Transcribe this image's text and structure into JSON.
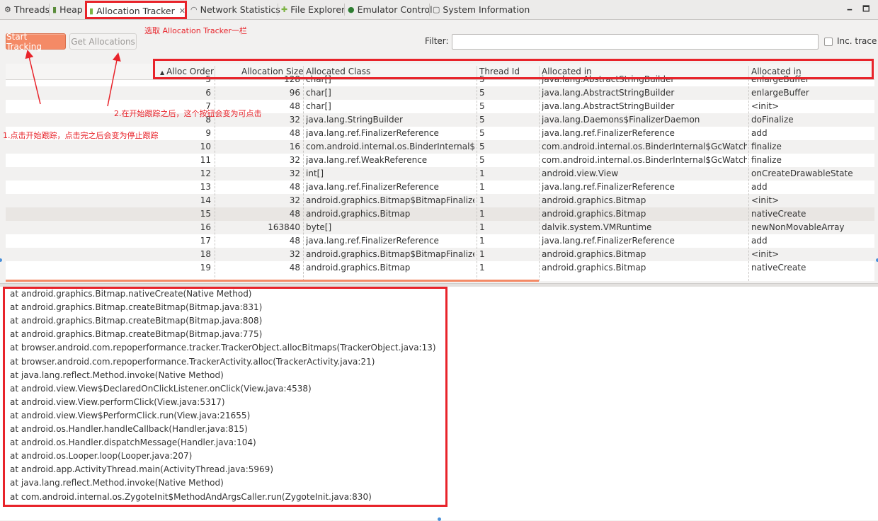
{
  "tabs": [
    {
      "label": "Threads",
      "icon": "threads-icon"
    },
    {
      "label": "Heap",
      "icon": "heap-icon"
    },
    {
      "label": "Allocation Tracker",
      "icon": "android-icon",
      "active": true
    },
    {
      "label": "Network Statistics",
      "icon": "wifi-icon"
    },
    {
      "label": "File Explorer",
      "icon": "android-icon"
    },
    {
      "label": "Emulator Control",
      "icon": "emulator-icon"
    },
    {
      "label": "System Information",
      "icon": "sysinfo-icon"
    }
  ],
  "window": {
    "minimize": "🗕",
    "maximize": "🗖"
  },
  "toolbar": {
    "start_label": "Start Tracking",
    "get_label": "Get Allocations",
    "filter_label": "Filter:",
    "filter_value": "",
    "inc_trace_label": "Inc. trace"
  },
  "annotations": {
    "tab_note": "选取 Allocation Tracker一栏",
    "note1": "1.点击开始跟踪，点击完之后会变为停止跟踪",
    "note2": "2.在开始跟踪之后，这个按钮会变为可点击"
  },
  "table": {
    "columns": [
      "Alloc Order",
      "Allocation Size",
      "Allocated Class",
      "Thread Id",
      "Allocated in",
      "Allocated in"
    ],
    "rows": [
      [
        "5",
        "128",
        "char[]",
        "5",
        "java.lang.AbstractStringBuilder",
        "enlargeBuffer"
      ],
      [
        "6",
        "96",
        "char[]",
        "5",
        "java.lang.AbstractStringBuilder",
        "enlargeBuffer"
      ],
      [
        "7",
        "48",
        "char[]",
        "5",
        "java.lang.AbstractStringBuilder",
        "<init>"
      ],
      [
        "8",
        "32",
        "java.lang.StringBuilder",
        "5",
        "java.lang.Daemons$FinalizerDaemon",
        "doFinalize"
      ],
      [
        "9",
        "48",
        "java.lang.ref.FinalizerReference",
        "5",
        "java.lang.ref.FinalizerReference",
        "add"
      ],
      [
        "10",
        "16",
        "com.android.internal.os.BinderInternal$Gc",
        "5",
        "com.android.internal.os.BinderInternal$GcWatcher",
        "finalize"
      ],
      [
        "11",
        "32",
        "java.lang.ref.WeakReference",
        "5",
        "com.android.internal.os.BinderInternal$GcWatcher",
        "finalize"
      ],
      [
        "12",
        "32",
        "int[]",
        "1",
        "android.view.View",
        "onCreateDrawableState"
      ],
      [
        "13",
        "48",
        "java.lang.ref.FinalizerReference",
        "1",
        "java.lang.ref.FinalizerReference",
        "add"
      ],
      [
        "14",
        "32",
        "android.graphics.Bitmap$BitmapFinalizer",
        "1",
        "android.graphics.Bitmap",
        "<init>"
      ],
      [
        "15",
        "48",
        "android.graphics.Bitmap",
        "1",
        "android.graphics.Bitmap",
        "nativeCreate"
      ],
      [
        "16",
        "163840",
        "byte[]",
        "1",
        "dalvik.system.VMRuntime",
        "newNonMovableArray"
      ],
      [
        "17",
        "48",
        "java.lang.ref.FinalizerReference",
        "1",
        "java.lang.ref.FinalizerReference",
        "add"
      ],
      [
        "18",
        "32",
        "android.graphics.Bitmap$BitmapFinalizer",
        "1",
        "android.graphics.Bitmap",
        "<init>"
      ],
      [
        "19",
        "48",
        "android.graphics.Bitmap",
        "1",
        "android.graphics.Bitmap",
        "nativeCreate"
      ]
    ]
  },
  "trace": [
    "at android.graphics.Bitmap.nativeCreate(Native Method)",
    "at android.graphics.Bitmap.createBitmap(Bitmap.java:831)",
    "at android.graphics.Bitmap.createBitmap(Bitmap.java:808)",
    "at android.graphics.Bitmap.createBitmap(Bitmap.java:775)",
    "at browser.android.com.repoperformance.tracker.TrackerObject.allocBitmaps(TrackerObject.java:13)",
    "at browser.android.com.repoperformance.TrackerActivity.alloc(TrackerActivity.java:21)",
    "at java.lang.reflect.Method.invoke(Native Method)",
    "at android.view.View$DeclaredOnClickListener.onClick(View.java:4538)",
    "at android.view.View.performClick(View.java:5317)",
    "at android.view.View$PerformClick.run(View.java:21655)",
    "at android.os.Handler.handleCallback(Handler.java:815)",
    "at android.os.Handler.dispatchMessage(Handler.java:104)",
    "at android.os.Looper.loop(Looper.java:207)",
    "at android.app.ActivityThread.main(ActivityThread.java:5969)",
    "at java.lang.reflect.Method.invoke(Native Method)",
    "at com.android.internal.os.ZygoteInit$MethodAndArgsCaller.run(ZygoteInit.java:830)"
  ],
  "colors": {
    "accent": "#f48a66",
    "annotation_red": "#e8232a"
  }
}
